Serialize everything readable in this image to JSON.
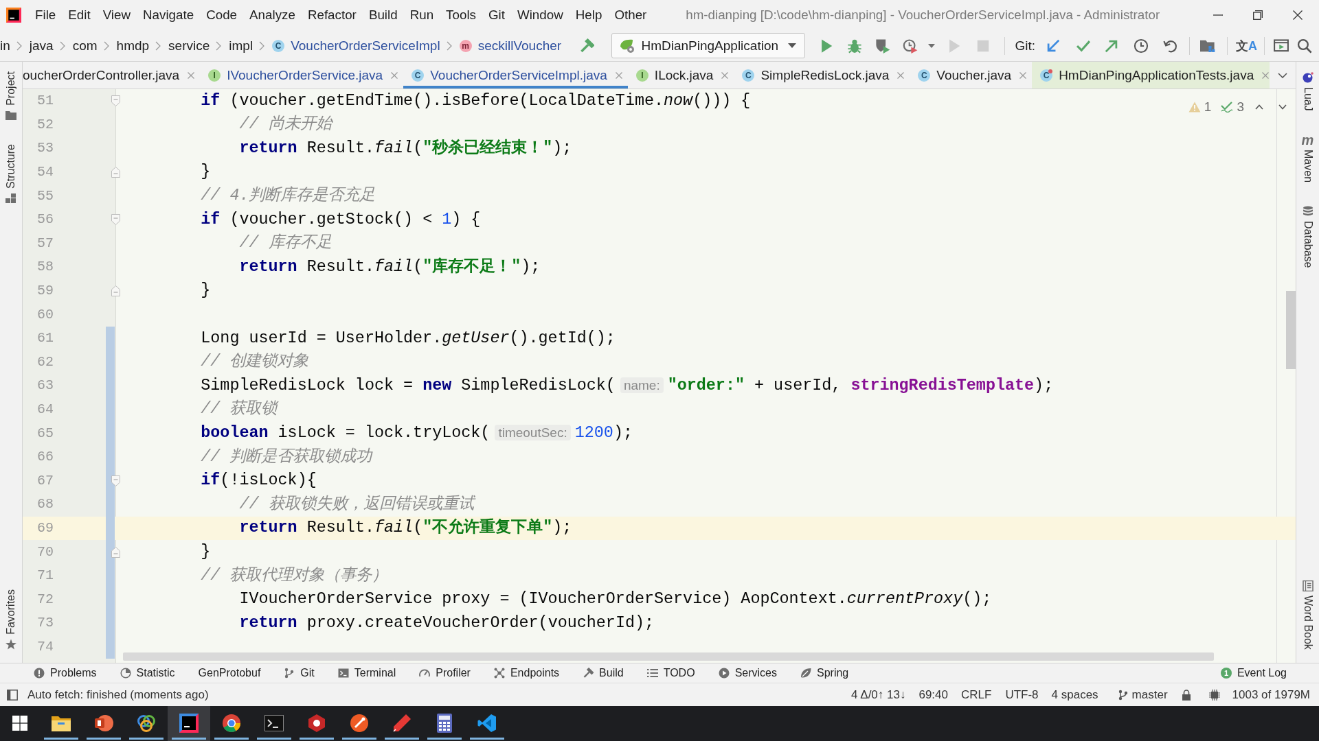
{
  "window": {
    "title": "hm-dianping [D:\\code\\hm-dianping] - VoucherOrderServiceImpl.java - Administrator"
  },
  "menu": [
    "File",
    "Edit",
    "View",
    "Navigate",
    "Code",
    "Analyze",
    "Refactor",
    "Build",
    "Run",
    "Tools",
    "Git",
    "Window",
    "Help",
    "Other"
  ],
  "breadcrumbs": [
    {
      "label": "in",
      "kind": "folder"
    },
    {
      "label": "java",
      "kind": "folder"
    },
    {
      "label": "com",
      "kind": "folder"
    },
    {
      "label": "hmdp",
      "kind": "folder"
    },
    {
      "label": "service",
      "kind": "folder"
    },
    {
      "label": "impl",
      "kind": "folder"
    },
    {
      "label": "VoucherOrderServiceImpl",
      "kind": "class",
      "icon": "C"
    },
    {
      "label": "seckillVoucher",
      "kind": "method",
      "icon": "m"
    }
  ],
  "toolbar": {
    "run_configuration": "HmDianPingApplication",
    "rerun": {
      "disabled": true
    },
    "stop": {
      "disabled": true
    },
    "git_label": "Git:",
    "translate_icon": "文A"
  },
  "tabs": [
    {
      "label": "oucherOrderController.java",
      "modified": false,
      "selected": false
    },
    {
      "label": "IVoucherOrderService.java",
      "kind": "interface",
      "icon": "I",
      "modified": true,
      "selected": false
    },
    {
      "label": "VoucherOrderServiceImpl.java",
      "kind": "class",
      "icon": "C",
      "modified": true,
      "selected": true
    },
    {
      "label": "ILock.java",
      "kind": "interface",
      "icon": "I",
      "modified": false,
      "selected": false
    },
    {
      "label": "SimpleRedisLock.java",
      "kind": "class",
      "icon": "C",
      "modified": false,
      "selected": false
    },
    {
      "label": "Voucher.java",
      "kind": "class",
      "icon": "C",
      "modified": false,
      "selected": false
    },
    {
      "label": "HmDianPingApplicationTests.java",
      "kind": "test",
      "icon": "C",
      "modified": false,
      "selected": false
    }
  ],
  "left_tool_windows": {
    "top": [
      {
        "label": "Project",
        "kind": "project"
      },
      {
        "label": "Structure",
        "kind": "structure"
      }
    ],
    "bottom": [
      {
        "label": "Favorites",
        "kind": "favorites"
      }
    ]
  },
  "right_tool_windows": {
    "top": [
      {
        "label": "LuaJ",
        "kind": "luaj"
      },
      {
        "label": "Maven",
        "kind": "maven",
        "icon": "m"
      },
      {
        "label": "Database",
        "kind": "database"
      }
    ],
    "bottom": [
      {
        "label": "Word Book",
        "kind": "book"
      }
    ]
  },
  "editor": {
    "inspections": {
      "warnings": "1",
      "weak_warnings": "3"
    },
    "lines": [
      {
        "number": "51",
        "tokens": [
          {
            "kind": "keyword",
            "text": "        if"
          },
          {
            "kind": "plain",
            "text": " (voucher.getEndTime().isBefore(LocalDateTime."
          },
          {
            "kind": "italic",
            "text": "now"
          },
          {
            "kind": "plain",
            "text": "())) {"
          }
        ],
        "fold": {
          "kind": "start"
        },
        "modified": false,
        "current": false
      },
      {
        "number": "52",
        "tokens": [
          {
            "kind": "comment",
            "text": "            // 尚未开始"
          }
        ],
        "modified": false,
        "current": false
      },
      {
        "number": "53",
        "tokens": [
          {
            "kind": "keyword",
            "text": "            return"
          },
          {
            "kind": "plain",
            "text": " Result."
          },
          {
            "kind": "italic",
            "text": "fail"
          },
          {
            "kind": "plain",
            "text": "("
          },
          {
            "kind": "string",
            "text": "\"秒杀已经结束！\""
          },
          {
            "kind": "plain",
            "text": ");"
          }
        ],
        "modified": false,
        "current": false
      },
      {
        "number": "54",
        "tokens": [
          {
            "kind": "plain",
            "text": "        }"
          }
        ],
        "fold": {
          "kind": "end"
        },
        "modified": false,
        "current": false
      },
      {
        "number": "55",
        "tokens": [
          {
            "kind": "comment",
            "text": "        // 4.判断库存是否充足"
          }
        ],
        "modified": false,
        "current": false
      },
      {
        "number": "56",
        "tokens": [
          {
            "kind": "keyword",
            "text": "        if"
          },
          {
            "kind": "plain",
            "text": " (voucher.getStock() < "
          },
          {
            "kind": "number",
            "text": "1"
          },
          {
            "kind": "plain",
            "text": ") {"
          }
        ],
        "fold": {
          "kind": "start"
        },
        "modified": false,
        "current": false
      },
      {
        "number": "57",
        "tokens": [
          {
            "kind": "comment",
            "text": "            // 库存不足"
          }
        ],
        "modified": false,
        "current": false
      },
      {
        "number": "58",
        "tokens": [
          {
            "kind": "keyword",
            "text": "            return"
          },
          {
            "kind": "plain",
            "text": " Result."
          },
          {
            "kind": "italic",
            "text": "fail"
          },
          {
            "kind": "plain",
            "text": "("
          },
          {
            "kind": "string",
            "text": "\"库存不足！\""
          },
          {
            "kind": "plain",
            "text": ");"
          }
        ],
        "modified": false,
        "current": false
      },
      {
        "number": "59",
        "tokens": [
          {
            "kind": "plain",
            "text": "        }"
          }
        ],
        "fold": {
          "kind": "end"
        },
        "modified": false,
        "current": false
      },
      {
        "number": "60",
        "modified": false,
        "current": false
      },
      {
        "number": "61",
        "tokens": [
          {
            "kind": "plain",
            "text": "        Long userId = UserHolder."
          },
          {
            "kind": "italic",
            "text": "getUser"
          },
          {
            "kind": "plain",
            "text": "().getId();"
          }
        ],
        "modified": true,
        "current": false
      },
      {
        "number": "62",
        "tokens": [
          {
            "kind": "comment",
            "text": "        // 创建锁对象"
          }
        ],
        "modified": true,
        "current": false
      },
      {
        "number": "63",
        "tokens": [
          {
            "kind": "plain",
            "text": "        SimpleRedisLock lock = "
          },
          {
            "kind": "keyword",
            "text": "new"
          },
          {
            "kind": "plain",
            "text": " SimpleRedisLock("
          },
          {
            "kind": "hint",
            "text": "name:"
          },
          {
            "kind": "string",
            "text": "\"order:\""
          },
          {
            "kind": "plain",
            "text": " + userId, "
          },
          {
            "kind": "field",
            "text": "stringRedisTemplate"
          },
          {
            "kind": "plain",
            "text": ");"
          }
        ],
        "modified": true,
        "current": false
      },
      {
        "number": "64",
        "tokens": [
          {
            "kind": "comment",
            "text": "        // 获取锁"
          }
        ],
        "modified": true,
        "current": false
      },
      {
        "number": "65",
        "tokens": [
          {
            "kind": "keyword",
            "text": "        boolean"
          },
          {
            "kind": "plain",
            "text": " isLock = lock.tryLock("
          },
          {
            "kind": "hint",
            "text": "timeoutSec:"
          },
          {
            "kind": "number",
            "text": "1200"
          },
          {
            "kind": "plain",
            "text": ");"
          }
        ],
        "modified": true,
        "current": false
      },
      {
        "number": "66",
        "tokens": [
          {
            "kind": "comment",
            "text": "        // 判断是否获取锁成功"
          }
        ],
        "modified": true,
        "current": false
      },
      {
        "number": "67",
        "tokens": [
          {
            "kind": "keyword",
            "text": "        if"
          },
          {
            "kind": "plain",
            "text": "(!isLock){"
          }
        ],
        "fold": {
          "kind": "start"
        },
        "modified": true,
        "current": false
      },
      {
        "number": "68",
        "tokens": [
          {
            "kind": "comment",
            "text": "            // 获取锁失败，返回错误或重试"
          }
        ],
        "modified": true,
        "current": false
      },
      {
        "number": "69",
        "tokens": [
          {
            "kind": "keyword",
            "text": "            return"
          },
          {
            "kind": "plain",
            "text": " Result."
          },
          {
            "kind": "italic",
            "text": "fail"
          },
          {
            "kind": "plain",
            "text": "("
          },
          {
            "kind": "string",
            "text": "\"不允许重复下单\""
          },
          {
            "kind": "plain",
            "text": ");"
          }
        ],
        "modified": true,
        "current": true
      },
      {
        "number": "70",
        "tokens": [
          {
            "kind": "plain",
            "text": "        }"
          }
        ],
        "fold": {
          "kind": "end"
        },
        "modified": true,
        "current": false
      },
      {
        "number": "71",
        "tokens": [
          {
            "kind": "comment",
            "text": "        // 获取代理对象（事务）"
          }
        ],
        "modified": true,
        "current": false
      },
      {
        "number": "72",
        "tokens": [
          {
            "kind": "plain",
            "text": "            IVoucherOrderService proxy = (IVoucherOrderService) AopContext."
          },
          {
            "kind": "italic",
            "text": "currentProxy"
          },
          {
            "kind": "plain",
            "text": "();"
          }
        ],
        "modified": true,
        "current": false
      },
      {
        "number": "73",
        "tokens": [
          {
            "kind": "keyword",
            "text": "            return"
          },
          {
            "kind": "plain",
            "text": " proxy.createVoucherOrder(voucherId);"
          }
        ],
        "modified": true,
        "current": false
      },
      {
        "number": "74",
        "modified": true,
        "current": false
      }
    ]
  },
  "bottom_tool_windows": [
    {
      "label": "Problems",
      "kind": "problems"
    },
    {
      "label": "Statistic",
      "kind": "statistic"
    },
    {
      "label": "GenProtobuf",
      "kind": "plain"
    },
    {
      "label": "Git",
      "kind": "git"
    },
    {
      "label": "Terminal",
      "kind": "terminal"
    },
    {
      "label": "Profiler",
      "kind": "profiler"
    },
    {
      "label": "Endpoints",
      "kind": "endpoints"
    },
    {
      "label": "Build",
      "kind": "build"
    },
    {
      "label": "TODO",
      "kind": "todo"
    },
    {
      "label": "Services",
      "kind": "services"
    },
    {
      "label": "Spring",
      "kind": "spring"
    }
  ],
  "event_log": {
    "label": "Event Log",
    "count": "1"
  },
  "status_bar": {
    "message": "Auto fetch: finished (moments ago)",
    "vcs_changes": "4 Δ/0↑ 13↓",
    "caret_position": "69:40",
    "line_separator": "CRLF",
    "encoding": "UTF-8",
    "indent": "4 spaces",
    "branch": "master",
    "memory": "1003 of 1979M"
  },
  "taskbar": {
    "apps": [
      {
        "kind": "start",
        "active": false
      },
      {
        "kind": "explorer",
        "active": false,
        "running": true
      },
      {
        "kind": "presentation",
        "active": false,
        "running": true
      },
      {
        "kind": "rings",
        "active": false,
        "running": true
      },
      {
        "kind": "ide",
        "active": true,
        "running": true
      },
      {
        "kind": "browser",
        "active": false,
        "running": true
      },
      {
        "kind": "terminal",
        "active": false,
        "running": true
      },
      {
        "kind": "hexagon",
        "active": false,
        "running": true
      },
      {
        "kind": "orb",
        "active": false,
        "running": true
      },
      {
        "kind": "pen",
        "active": false,
        "running": true
      },
      {
        "kind": "calculator",
        "active": false,
        "running": true
      },
      {
        "kind": "code",
        "active": false,
        "running": true
      }
    ]
  }
}
